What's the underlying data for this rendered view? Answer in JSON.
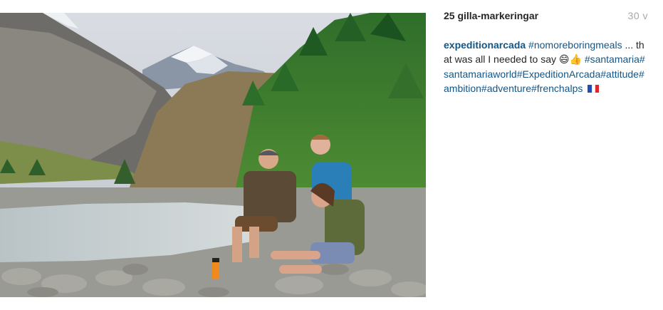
{
  "post": {
    "likes": "25 gilla-markeringar",
    "age": "30 v",
    "username": "expeditionarcada",
    "caption_parts": [
      {
        "type": "tag",
        "text": "#nomoreboringmeals"
      },
      {
        "type": "text",
        "text": " ... that was all I needed to say "
      },
      {
        "type": "emoji",
        "text": "😄"
      },
      {
        "type": "emoji",
        "text": "👍"
      },
      {
        "type": "text",
        "text": " "
      },
      {
        "type": "tag",
        "text": "#santamaria"
      },
      {
        "type": "tag",
        "text": "#santamariaworld"
      },
      {
        "type": "tag",
        "text": "#ExpeditionArcada"
      },
      {
        "type": "tag",
        "text": "#attitude"
      },
      {
        "type": "tag",
        "text": "#ambition"
      },
      {
        "type": "tag",
        "text": "#adventure"
      },
      {
        "type": "tag",
        "text": "#frenchalps"
      }
    ],
    "flag_colors": [
      "#1f4fb4",
      "#ffffff",
      "#e0262d"
    ]
  },
  "colors": {
    "link": "#125688",
    "text": "#262626",
    "muted": "#a8a8a8"
  }
}
